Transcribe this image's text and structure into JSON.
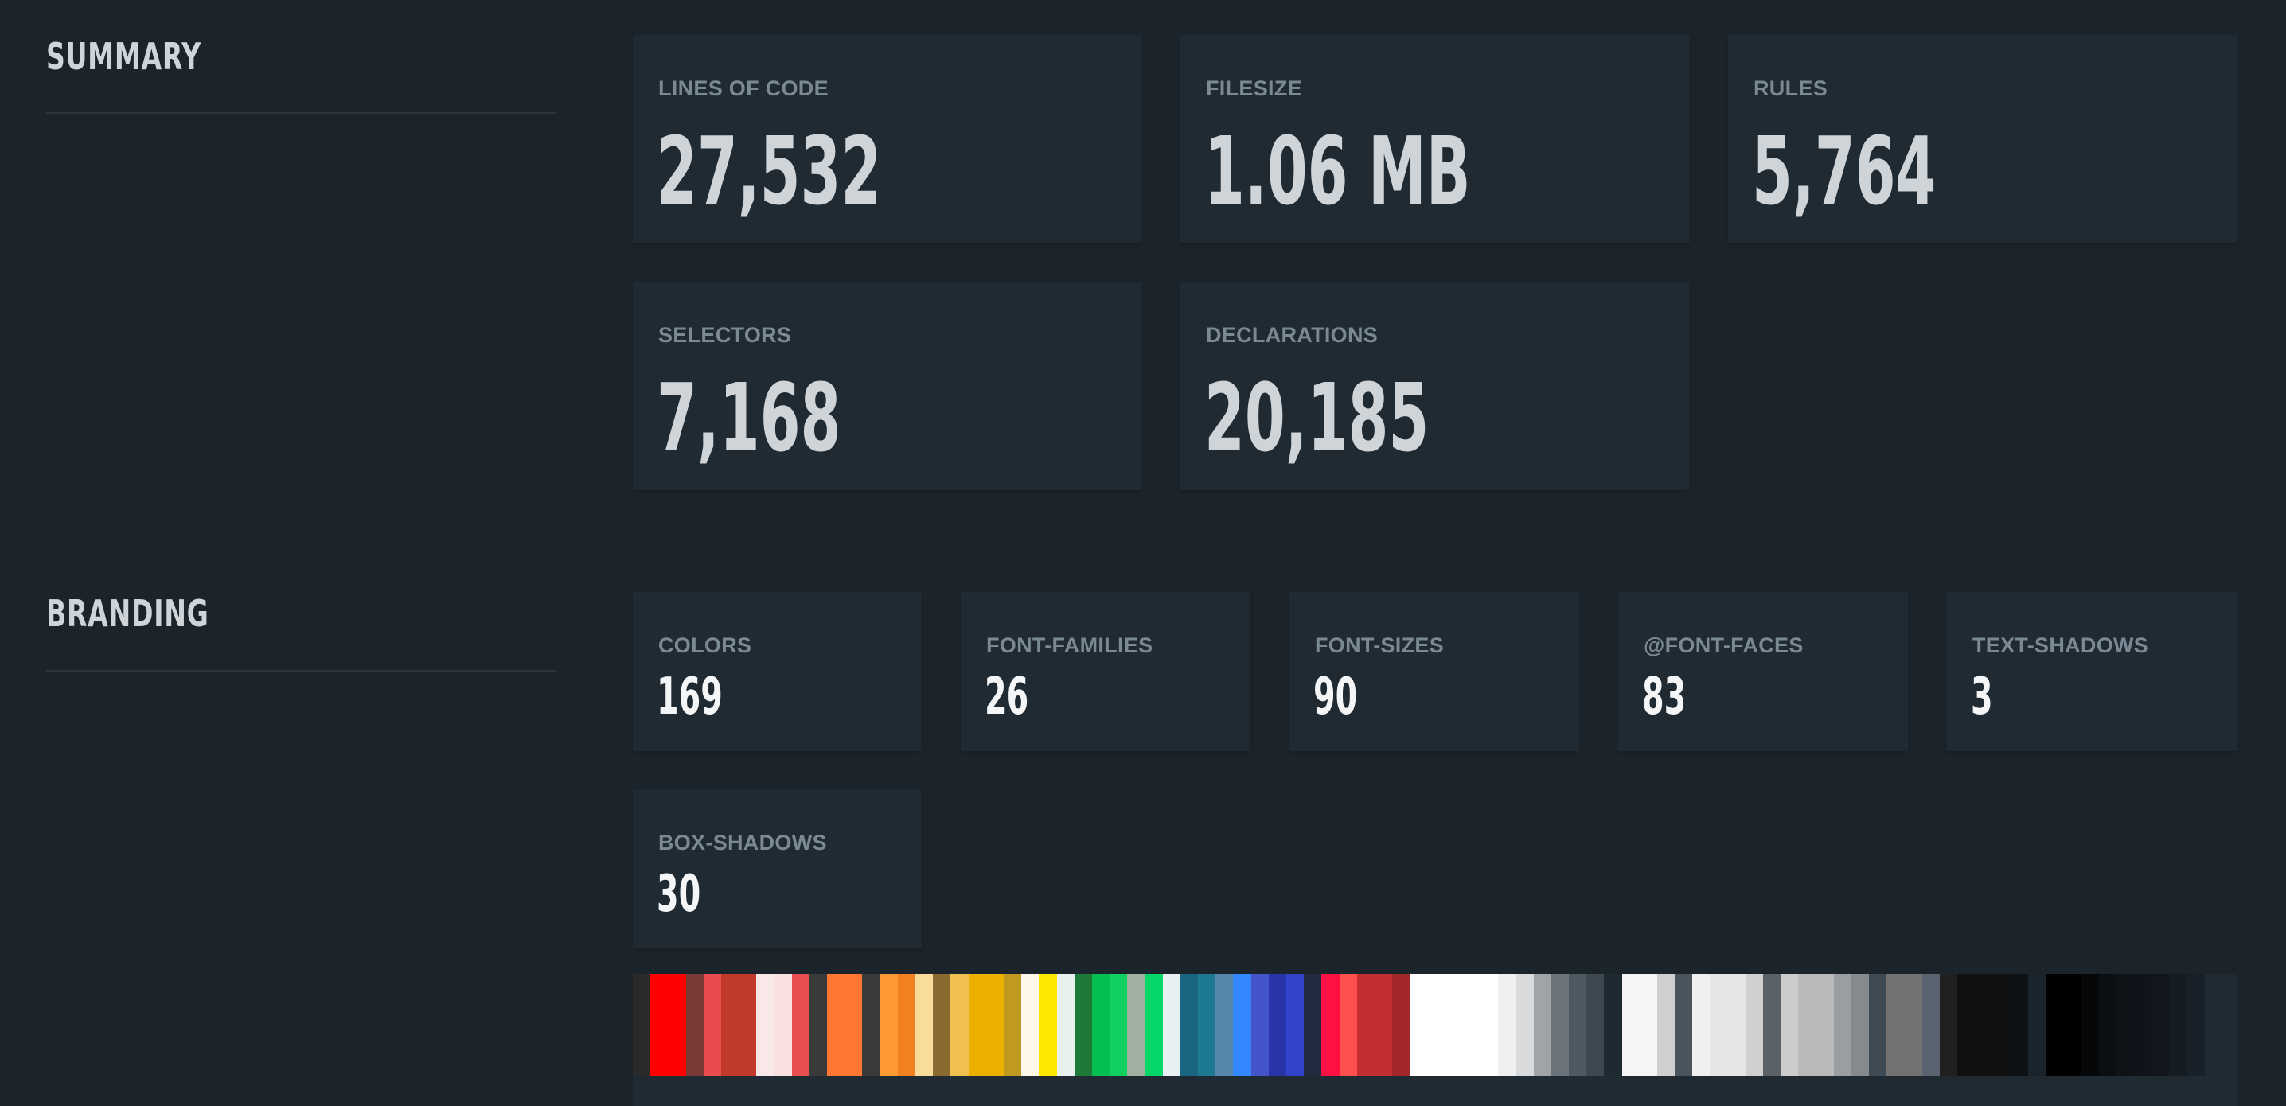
{
  "summary": {
    "title": "SUMMARY",
    "cards": [
      {
        "label": "LINES OF CODE",
        "value": "27,532"
      },
      {
        "label": "FILESIZE",
        "value": "1.06 MB"
      },
      {
        "label": "RULES",
        "value": "5,764"
      },
      {
        "label": "SELECTORS",
        "value": "7,168"
      },
      {
        "label": "DECLARATIONS",
        "value": "20,185"
      }
    ]
  },
  "branding": {
    "title": "BRANDING",
    "cards": [
      {
        "label": "COLORS",
        "value": "169"
      },
      {
        "label": "FONT-FAMILIES",
        "value": "26"
      },
      {
        "label": "FONT-SIZES",
        "value": "90"
      },
      {
        "label": "@FONT-FACES",
        "value": "83"
      },
      {
        "label": "TEXT-SHADOWS",
        "value": "3"
      },
      {
        "label": "BOX-SHADOWS",
        "value": "30"
      }
    ],
    "palette": [
      "#2a2a2a",
      "#ff0000",
      "#ff0000",
      "#7a3a38",
      "#e84c4c",
      "#c0392b",
      "#c0392b",
      "#f9e8e8",
      "#f9e0e0",
      "#e85050",
      "#3a3a3a",
      "#ff7733",
      "#ff7733",
      "#3a3a3a",
      "#ff9933",
      "#f08020",
      "#f9dc9a",
      "#8a6a30",
      "#f0c050",
      "#ebb000",
      "#ebb000",
      "#c09a20",
      "#fff8e8",
      "#ffe800",
      "#e8f0f0",
      "#1e7a38",
      "#05c050",
      "#10d060",
      "#a0b0a0",
      "#05d868",
      "#e8f0f4",
      "#196680",
      "#1e7a90",
      "#5588aa",
      "#3388ff",
      "#4455cc",
      "#2834a8",
      "#3344cc",
      "#222a40",
      "#ff1144",
      "#ff5050",
      "#c42e30",
      "#c42e30",
      "#a2282a",
      "#ffffff",
      "#ffffff",
      "#ffffff",
      "#ffffff",
      "#ffffff",
      "#f0f0f0",
      "#d8dadb",
      "#a0a4a6",
      "#6a747a",
      "#4e5a62",
      "#3e4850",
      "#1e2a32",
      "#f5f5f5",
      "#f5f5f5",
      "#cfcfcf",
      "#4a545c",
      "#f0f0f0",
      "#e6e6e6",
      "#e6e6e6",
      "#d0d0d0",
      "#5a6268",
      "#cccccc",
      "#bababa",
      "#bababa",
      "#9a9ea2",
      "#858a8e",
      "#3e4a54",
      "#727272",
      "#727272",
      "#5a6470",
      "#202020",
      "#101010",
      "#101010",
      "#101010",
      "#0e1214",
      "#1a242c",
      "#000000",
      "#000000",
      "#050708",
      "#0c0f12",
      "#0e1318",
      "#0f141a",
      "#11171d",
      "#151d23",
      "#18212a"
    ]
  }
}
